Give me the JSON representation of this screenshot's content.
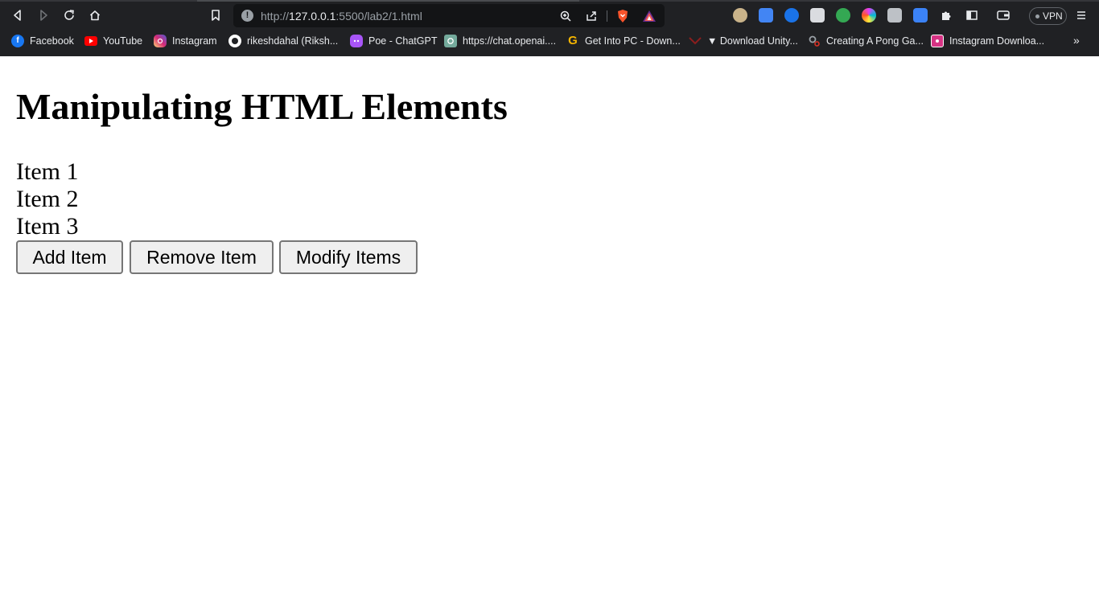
{
  "browser": {
    "address_bar": {
      "url_prefix": "http://",
      "url_host": "127.0.0.1",
      "url_rest": ":5500/lab2/1.html"
    },
    "vpn_label": "VPN",
    "extensions": [
      {
        "icon": "owl-extension-icon",
        "color": "#c9b38a"
      },
      {
        "icon": "google-translate-icon",
        "color": "#4285f4"
      },
      {
        "icon": "shazam-icon",
        "color": "#1a73e8"
      },
      {
        "icon": "ghost-extension-icon",
        "color": "#dadce0"
      },
      {
        "icon": "chatgpt-extension-icon",
        "color": "#34a853"
      },
      {
        "icon": "color-picker-icon",
        "color": "#e040fb"
      },
      {
        "icon": "window-copy-icon",
        "color": "#bdc1c6"
      },
      {
        "icon": "ai-tool-extension-icon",
        "color": "#3b82f6"
      }
    ],
    "bookmarks": [
      {
        "label": "Facebook",
        "icon": "facebook-icon",
        "color": "#1877f2"
      },
      {
        "label": "YouTube",
        "icon": "youtube-icon",
        "color": "#ff0000"
      },
      {
        "label": "Instagram",
        "icon": "instagram-icon",
        "color": "#e1306c"
      },
      {
        "label": "rikeshdahal (Riksh...",
        "icon": "github-icon",
        "color": "#ffffff"
      },
      {
        "label": "Poe - ChatGPT",
        "icon": "poe-icon",
        "color": "#a855f7"
      },
      {
        "label": "https://chat.openai....",
        "icon": "openai-icon",
        "color": "#74aa9c"
      },
      {
        "label": "Get Into PC - Down...",
        "icon": "getintopc-icon",
        "color": "#f4b400"
      },
      {
        "label": "▼ Download Unity...",
        "icon": "unity-download-icon",
        "color": "#8b1e1e"
      },
      {
        "label": "Creating A Pong Ga...",
        "icon": "gears-icon",
        "color": "#9aa0a6"
      },
      {
        "label": "Instagram Downloa...",
        "icon": "instagram-downloader-icon",
        "color": "#d63384"
      }
    ]
  },
  "page": {
    "title": "Manipulating HTML Elements",
    "items": [
      "Item 1",
      "Item 2",
      "Item 3"
    ],
    "buttons": {
      "add": "Add Item",
      "remove": "Remove Item",
      "modify": "Modify Items"
    }
  }
}
